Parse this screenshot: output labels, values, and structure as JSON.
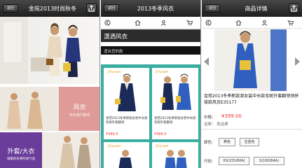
{
  "pane1": {
    "back_label": "返回",
    "title": "金苑2013时尚秋冬",
    "tile_fengyi": {
      "title": "风衣",
      "subtitle": "今年流行款式"
    },
    "tile_waitao": {
      "title": "外套/大衣",
      "subtitle": "温暖的冬季时尚气息"
    }
  },
  "pane2": {
    "back_label": "返回",
    "title": "2013冬季风衣",
    "category": "潇洒风衣",
    "subtitle": "适合您的款",
    "products": [
      {
        "title": "金苑2013冬季新款女装中长款毛呢外套翻领",
        "price": "¥369.0"
      },
      {
        "title": "金苑2013冬季新款女装中长款毛呢外套翻领",
        "price": "¥369.0"
      }
    ],
    "brand_tag": "Jinyuan"
  },
  "pane3": {
    "back_label": "返回",
    "title": "商品详情",
    "product_title": "金苑2013冬季新款淑女装中长款毛呢外套翻领领拼接款风衣E35177",
    "price_label": "价格：",
    "price": "¥399.00",
    "freight": "运费：   免运费",
    "color_label": "颜色:",
    "colors": [
      "黄色",
      "宝蓝色"
    ],
    "size_label": "尺码:",
    "sizes": [
      "XS(155/80A)",
      "S(160/84A)"
    ]
  },
  "colors": {
    "teal": "#3aaea0",
    "coat_blue": "#2f5fbf",
    "navy": "#1c2a57",
    "price_red": "#ee3333",
    "pink_tile": "#e09a98",
    "purple_tile": "#6a3d9a"
  }
}
